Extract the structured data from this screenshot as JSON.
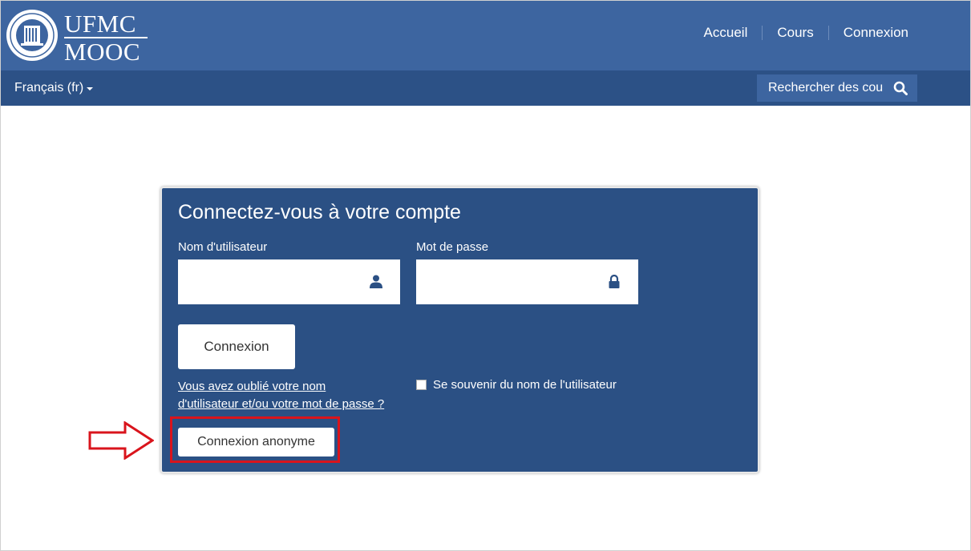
{
  "header": {
    "logo": {
      "line1": "UFMC",
      "line2": "MOOC"
    },
    "nav": [
      {
        "label": "Accueil"
      },
      {
        "label": "Cours"
      },
      {
        "label": "Connexion"
      }
    ]
  },
  "subheader": {
    "language": "Français (fr)",
    "search_placeholder": "Rechercher des cou"
  },
  "login": {
    "title": "Connectez-vous à votre compte",
    "username_label": "Nom d'utilisateur",
    "username_value": "",
    "password_label": "Mot de passe",
    "password_value": "",
    "login_button": "Connexion",
    "forgot_line1": "Vous avez oublié votre nom",
    "forgot_line2": "d'utilisateur et/ou votre mot de passe ?",
    "remember_label": "Se souvenir du nom de l'utilisateur",
    "remember_checked": false,
    "anonymous_button": "Connexion anonyme"
  },
  "colors": {
    "header": "#3d65a0",
    "subheader": "#2c5186",
    "card": "#2b5084",
    "highlight": "#d9141c"
  },
  "icons": [
    "user-icon",
    "lock-icon",
    "search-icon",
    "caret-down-icon",
    "arrow-right-icon"
  ]
}
